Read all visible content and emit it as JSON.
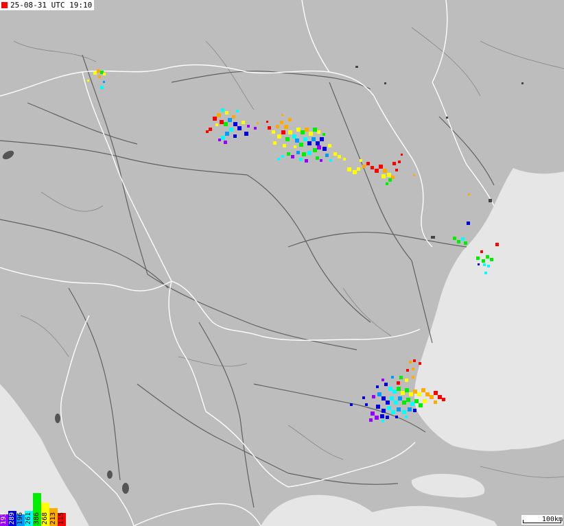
{
  "timestamp": "25-08-31 UTC 19:10",
  "scale_label": "100km",
  "legend": [
    {
      "label": "193",
      "color": "#9900ff",
      "level": 0.35
    },
    {
      "label": "289",
      "color": "#0000dd",
      "level": 0.45
    },
    {
      "label": "196",
      "color": "#0099ff",
      "level": 0.35
    },
    {
      "label": "261",
      "color": "#00ffff",
      "level": 0.45
    },
    {
      "label": "386",
      "color": "#00ee00",
      "level": 1.0
    },
    {
      "label": "268",
      "color": "#ffff00",
      "level": 0.7
    },
    {
      "label": "213",
      "color": "#ffaa00",
      "level": 0.55
    },
    {
      "label": "115",
      "color": "#ff0000",
      "level": 0.4
    }
  ],
  "colors": {
    "land": "#bdbdbd",
    "sea": "#e6e6e6",
    "border": "#ffffff",
    "road": "#555555"
  }
}
